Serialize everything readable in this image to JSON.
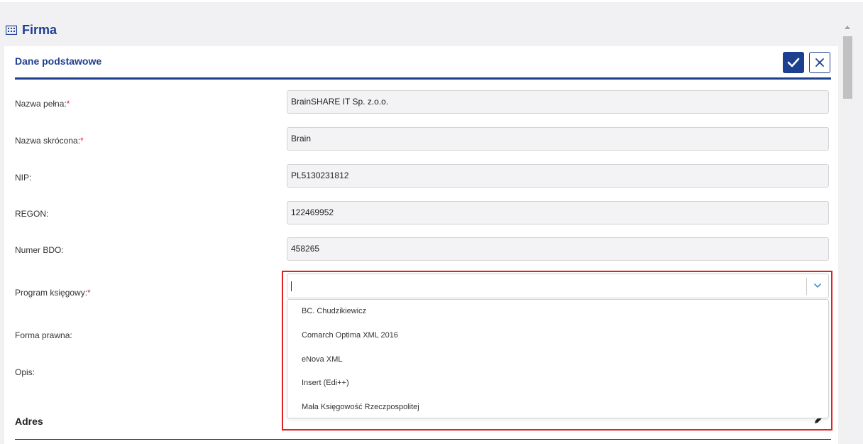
{
  "page": {
    "title": "Firma"
  },
  "card": {
    "title": "Dane podstawowe",
    "fields": [
      {
        "label": "Nazwa pełna:",
        "required": "*",
        "value": "BrainSHARE IT Sp. z.o.o."
      },
      {
        "label": "Nazwa skrócona:",
        "required": "*",
        "value": "Brain"
      },
      {
        "label": "NIP:",
        "required": "",
        "value": "PL5130231812"
      },
      {
        "label": "REGON:",
        "required": "",
        "value": "122469952"
      },
      {
        "label": "Numer BDO:",
        "required": "",
        "value": "458265"
      }
    ],
    "program": {
      "label": "Program księgowy:",
      "required": "*",
      "value": "",
      "options": [
        "BC. Chudzikiewicz",
        "Comarch Optima XML 2016",
        "eNova XML",
        "Insert (Edi++)",
        "Mała Księgowość Rzeczpospolitej"
      ]
    },
    "forma_label": "Forma prawna:",
    "opis_label": "Opis:"
  },
  "address": {
    "title": "Adres"
  },
  "colors": {
    "accent": "#1d3f8f",
    "required": "#d9232d",
    "highlight": "#e0211f"
  },
  "icons": {
    "page": "building-icon",
    "confirm": "check-icon",
    "cancel": "close-icon",
    "dropdown": "chevron-down-icon",
    "edit": "pencil-icon"
  }
}
